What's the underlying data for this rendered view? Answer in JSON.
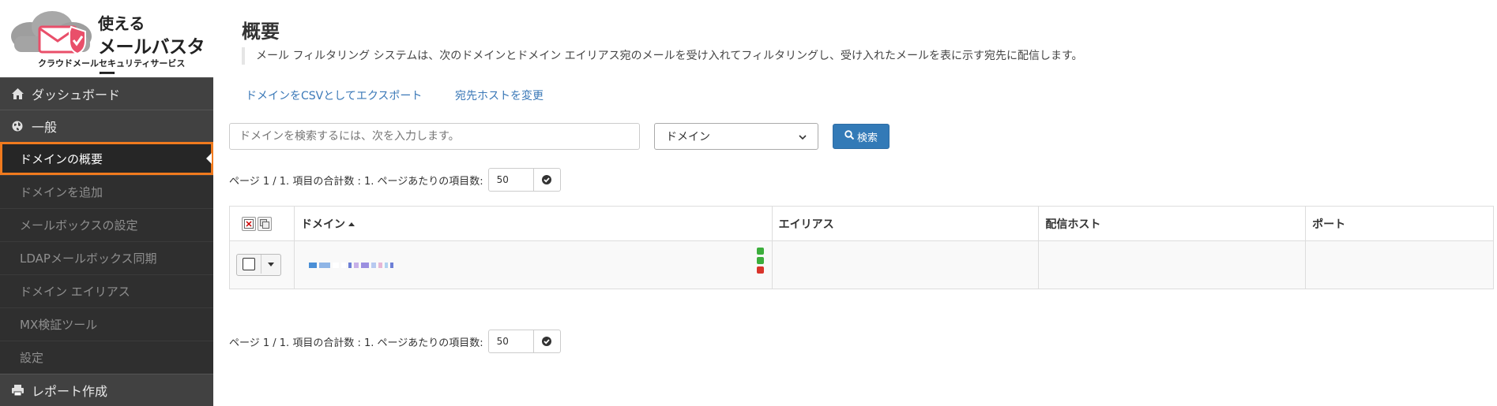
{
  "logo": {
    "line1": "使える",
    "line2": "メールバスター",
    "sub": "クラウドメールセキュリティサービス",
    "brand_color": "#e94f6a"
  },
  "sidebar": {
    "items": [
      {
        "label": "ダッシュボード",
        "icon": "home-icon",
        "type": "main"
      },
      {
        "label": "一般",
        "icon": "globe-icon",
        "type": "main"
      },
      {
        "label": "ドメインの概要",
        "type": "sub",
        "active": true
      },
      {
        "label": "ドメインを追加",
        "type": "sub"
      },
      {
        "label": "メールボックスの設定",
        "type": "sub"
      },
      {
        "label": "LDAPメールボックス同期",
        "type": "sub"
      },
      {
        "label": "ドメイン エイリアス",
        "type": "sub"
      },
      {
        "label": "MX検証ツール",
        "type": "sub"
      },
      {
        "label": "設定",
        "type": "sub"
      },
      {
        "label": "レポート作成",
        "icon": "printer-icon",
        "type": "main"
      }
    ],
    "highlight_color": "#f07a1e"
  },
  "main": {
    "title": "概要",
    "description": "メール フィルタリング システムは、次のドメインとドメイン エイリアス宛のメールを受け入れてフィルタリングし、受け入れたメールを表に示す宛先に配信します。",
    "links": {
      "export_csv": "ドメインをCSVとしてエクスポート",
      "change_host": "宛先ホストを変更"
    },
    "search": {
      "placeholder": "ドメインを検索するには、次を入力します。",
      "select_value": "ドメイン",
      "button_label": "検索"
    },
    "pager": {
      "text": "ページ 1 / 1. 項目の合計数 : 1. ページあたりの項目数:",
      "per_page": "50"
    },
    "table": {
      "columns": [
        "ドメイン",
        "エイリアス",
        "配信ホスト",
        "ポート"
      ],
      "status_colors": [
        "#3cae3c",
        "#3cae3c",
        "#d9342b"
      ]
    }
  }
}
